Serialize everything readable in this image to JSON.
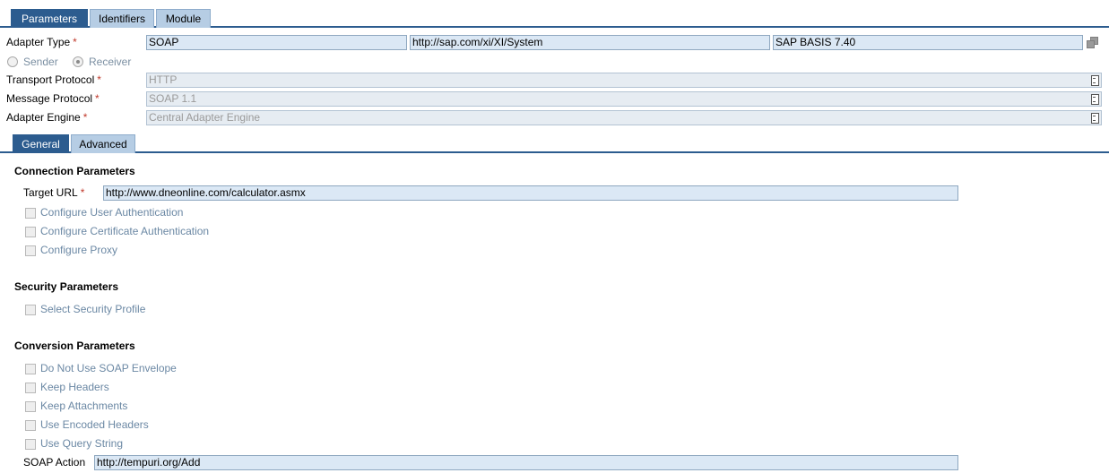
{
  "top_tabs": [
    "Parameters",
    "Identifiers",
    "Module"
  ],
  "adapter": {
    "adapter_type_label": "Adapter Type",
    "adapter_type_value": "SOAP",
    "namespace_value": "http://sap.com/xi/XI/System",
    "software_component_value": "SAP BASIS 7.40",
    "required_mark": "*",
    "sender_label": "Sender",
    "receiver_label": "Receiver",
    "direction_selected": "Receiver",
    "transport_protocol_label": "Transport Protocol",
    "transport_protocol_value": "HTTP",
    "message_protocol_label": "Message Protocol",
    "message_protocol_value": "SOAP 1.1",
    "adapter_engine_label": "Adapter Engine",
    "adapter_engine_value": "Central Adapter Engine"
  },
  "sub_tabs": [
    "General",
    "Advanced"
  ],
  "connection": {
    "title": "Connection Parameters",
    "target_url_label": "Target URL",
    "target_url_value": "http://www.dneonline.com/calculator.asmx",
    "options": [
      "Configure User Authentication",
      "Configure Certificate Authentication",
      "Configure Proxy"
    ]
  },
  "security": {
    "title": "Security Parameters",
    "options": [
      "Select Security Profile"
    ]
  },
  "conversion": {
    "title": "Conversion Parameters",
    "options": [
      "Do Not Use SOAP Envelope",
      "Keep Headers",
      "Keep Attachments",
      "Use Encoded Headers",
      "Use Query String"
    ],
    "soap_action_label": "SOAP Action",
    "soap_action_value": "http://tempuri.org/Add"
  },
  "colors": {
    "tab_active": "#2c5c8f",
    "tab_inactive": "#b6cde4",
    "field_bg": "#dbe8f5",
    "required": "#c0392b",
    "disabled_text": "#6b88a4"
  }
}
